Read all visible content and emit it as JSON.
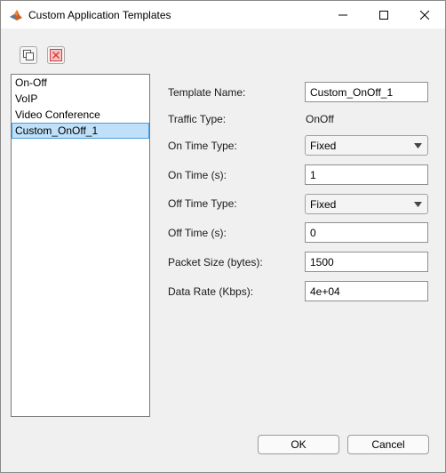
{
  "window": {
    "title": "Custom Application Templates"
  },
  "toolbar": {
    "copy_icon": "copy-icon",
    "delete_icon": "delete-icon"
  },
  "templates_list": {
    "items": [
      {
        "label": "On-Off",
        "selected": false
      },
      {
        "label": "VoIP",
        "selected": false
      },
      {
        "label": "Video Conference",
        "selected": false
      },
      {
        "label": "Custom_OnOff_1",
        "selected": true
      }
    ]
  },
  "form": {
    "template_name": {
      "label": "Template Name:",
      "value": "Custom_OnOff_1"
    },
    "traffic_type": {
      "label": "Traffic Type:",
      "value": "OnOff"
    },
    "on_time_type": {
      "label": "On Time Type:",
      "value": "Fixed"
    },
    "on_time": {
      "label": "On Time (s):",
      "value": "1"
    },
    "off_time_type": {
      "label": "Off Time Type:",
      "value": "Fixed"
    },
    "off_time": {
      "label": "Off Time (s):",
      "value": "0"
    },
    "packet_size": {
      "label": "Packet Size (bytes):",
      "value": "1500"
    },
    "data_rate": {
      "label": "Data Rate (Kbps):",
      "value": "4e+04"
    }
  },
  "buttons": {
    "ok": "OK",
    "cancel": "Cancel"
  },
  "colors": {
    "selection_bg": "#bfe0f8",
    "selection_border": "#4a9fe0",
    "delete_red": "#e0484a"
  }
}
